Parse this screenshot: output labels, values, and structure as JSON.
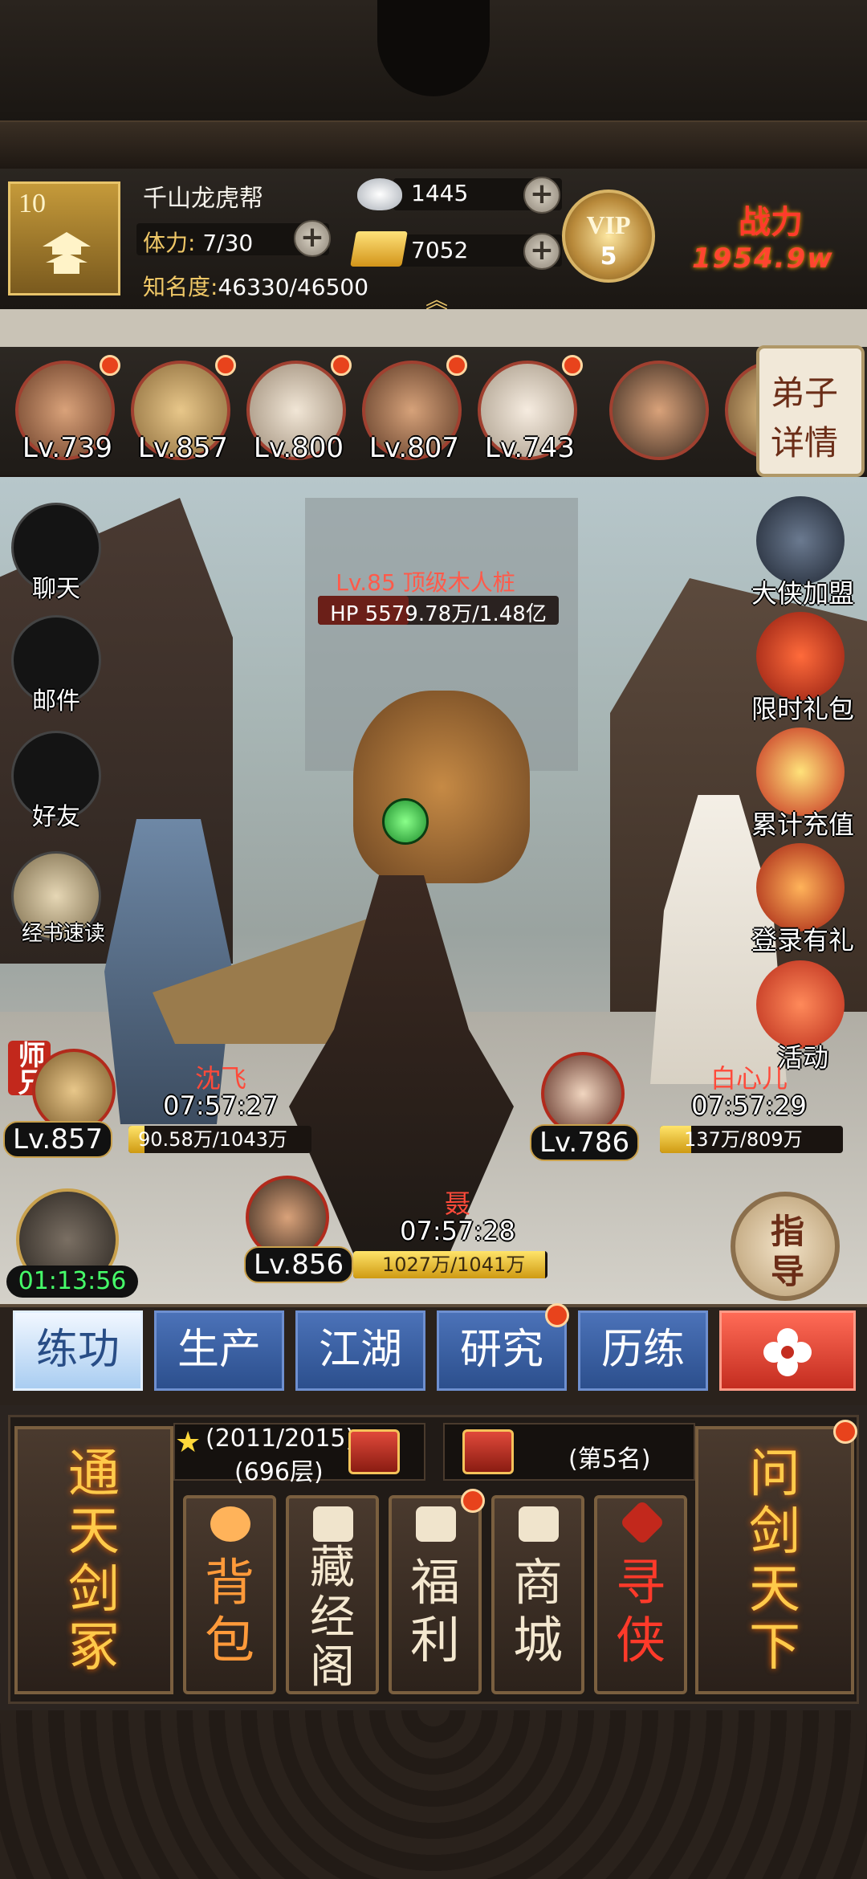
{
  "player": {
    "level": "10",
    "guild": "千山龙虎帮",
    "stamina_label": "体力:",
    "stamina": "7/30",
    "fame_label": "知名度:",
    "fame": "46330/46500",
    "fame_progress": 0.996
  },
  "currency": {
    "silver": "1445",
    "gold": "7052"
  },
  "vip": {
    "label": "VIP",
    "level": "5"
  },
  "power": {
    "label": "战力",
    "value": "1954.9w"
  },
  "heroes": [
    {
      "level": "Lv.739"
    },
    {
      "level": "Lv.857"
    },
    {
      "level": "Lv.800"
    },
    {
      "level": "Lv.807"
    },
    {
      "level": "Lv.743"
    }
  ],
  "detail_button": {
    "l1": "弟子",
    "l2": "详情"
  },
  "left_menu": {
    "chat": "聊天",
    "mail": "邮件",
    "friends": "好友",
    "speedread": "经书速读"
  },
  "right_menu": {
    "alliance": "大侠加盟",
    "limited_gift": "限时礼包",
    "recharge": "累计充值",
    "login_gift": "登录有礼",
    "activity": "活动"
  },
  "boss": {
    "name": "Lv.85 顶级木人桩",
    "hp": "HP 5579.78万/1.48亿",
    "hp_fraction": 0.377
  },
  "units": {
    "left": {
      "name": "沈飞",
      "time": "07:57:27",
      "level": "Lv.857",
      "hp": "90.58万/1043万",
      "hp_fraction": 0.087,
      "tag": "师兄"
    },
    "right": {
      "name": "白心儿",
      "time": "07:57:29",
      "level": "Lv.786",
      "hp": "137万/809万",
      "hp_fraction": 0.169
    },
    "center": {
      "name": "聂",
      "time": "07:57:28",
      "level": "Lv.856",
      "hp": "1027万/1041万",
      "hp_fraction": 0.987
    }
  },
  "timer": "01:13:56",
  "guide": {
    "l1": "指",
    "l2": "导"
  },
  "tabs": [
    "练功",
    "生产",
    "江湖",
    "研究",
    "历练"
  ],
  "bottom": {
    "left_scroll": "通天剑冢",
    "right_scroll": "问剑天下",
    "progress": "(2011/2015)",
    "floor": "(696层)",
    "rank": "(第5名)",
    "cards": [
      "背包",
      "藏经阁",
      "福利",
      "商城",
      "寻侠"
    ]
  },
  "colors": {
    "accent_red": "#e8431c",
    "tab_blue": "#4b72b8",
    "gold": "#f0c867"
  }
}
